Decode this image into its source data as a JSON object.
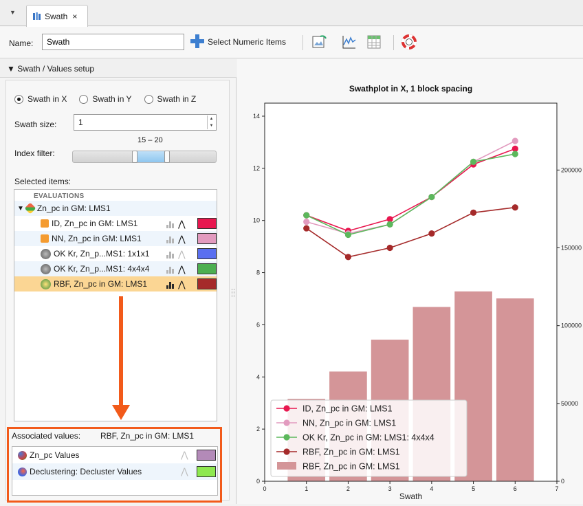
{
  "tab": {
    "label": "Swath",
    "close": "×",
    "menu": "▼"
  },
  "toolbar": {
    "name_label": "Name:",
    "name_value": "Swath",
    "select_label": "Select Numeric Items"
  },
  "setup": {
    "header": "▼ Swath / Values setup",
    "radios": [
      {
        "label": "Swath in X",
        "selected": true
      },
      {
        "label": "Swath in Y",
        "selected": false
      },
      {
        "label": "Swath in Z",
        "selected": false
      }
    ],
    "swath_size_label": "Swath size:",
    "swath_size_value": "1",
    "index_filter_label": "Index filter:",
    "index_filter_range": "15 – 20",
    "index_filter_lo": 15,
    "index_filter_hi": 20,
    "selected_items_label": "Selected items:"
  },
  "tree": {
    "header": "EVALUATIONS",
    "parent": "Zn_pc in GM: LMS1",
    "items": [
      {
        "label": "ID, Zn_pc in GM: LMS1",
        "color": "#e8174f"
      },
      {
        "label": "NN, Zn_pc in GM: LMS1",
        "color": "#e29bbf"
      },
      {
        "label": "OK Kr, Zn_p...MS1: 1x1x1",
        "color": "#5a6ff0"
      },
      {
        "label": "OK Kr, Zn_p...MS1: 4x4x4",
        "color": "#4caf50"
      },
      {
        "label": "RBF, Zn_pc in GM: LMS1",
        "color": "#a52a2a"
      }
    ]
  },
  "associated": {
    "label": "Associated values:",
    "selected": "RBF, Zn_pc in GM: LMS1",
    "items": [
      {
        "label": "Zn_pc Values",
        "color": "#b38ab8"
      },
      {
        "label": "Declustering: Decluster Values",
        "color": "#8ee850"
      }
    ]
  },
  "chart_data": {
    "type": "line",
    "title": "Swathplot in X, 1 block spacing",
    "xlabel": "Swath",
    "ylabel": "",
    "xlim": [
      0,
      7
    ],
    "ylim": [
      0,
      14.5
    ],
    "y2lim": [
      0,
      243000
    ],
    "xticks": [
      0,
      1,
      2,
      3,
      4,
      5,
      6,
      7
    ],
    "yticks": [
      0,
      2,
      4,
      6,
      8,
      10,
      12,
      14
    ],
    "y2ticks": [
      0,
      50000,
      100000,
      150000,
      200000
    ],
    "x": [
      1,
      2,
      3,
      4,
      5,
      6
    ],
    "series": [
      {
        "name": "ID, Zn_pc in GM: LMS1",
        "color": "#e8174f",
        "values": [
          10.2,
          9.6,
          10.05,
          10.9,
          12.15,
          12.75
        ]
      },
      {
        "name": "NN, Zn_pc in GM: LMS1",
        "color": "#e29bbf",
        "values": [
          9.95,
          9.5,
          9.85,
          10.9,
          12.25,
          13.05
        ]
      },
      {
        "name": "OK Kr, Zn_pc in GM: LMS1: 4x4x4",
        "color": "#5cb85c",
        "values": [
          10.2,
          9.45,
          9.85,
          10.9,
          12.25,
          12.55
        ]
      },
      {
        "name": "RBF, Zn_pc in GM: LMS1",
        "color": "#a52a2a",
        "values": [
          9.7,
          8.6,
          8.95,
          9.5,
          10.3,
          10.5
        ]
      }
    ],
    "bars": {
      "name": "RBF, Zn_pc in GM: LMS1",
      "color": "#d49598",
      "values": [
        53000,
        70500,
        91000,
        112000,
        122000,
        117500
      ]
    },
    "legend_position": "bottom-left",
    "grid": false
  }
}
